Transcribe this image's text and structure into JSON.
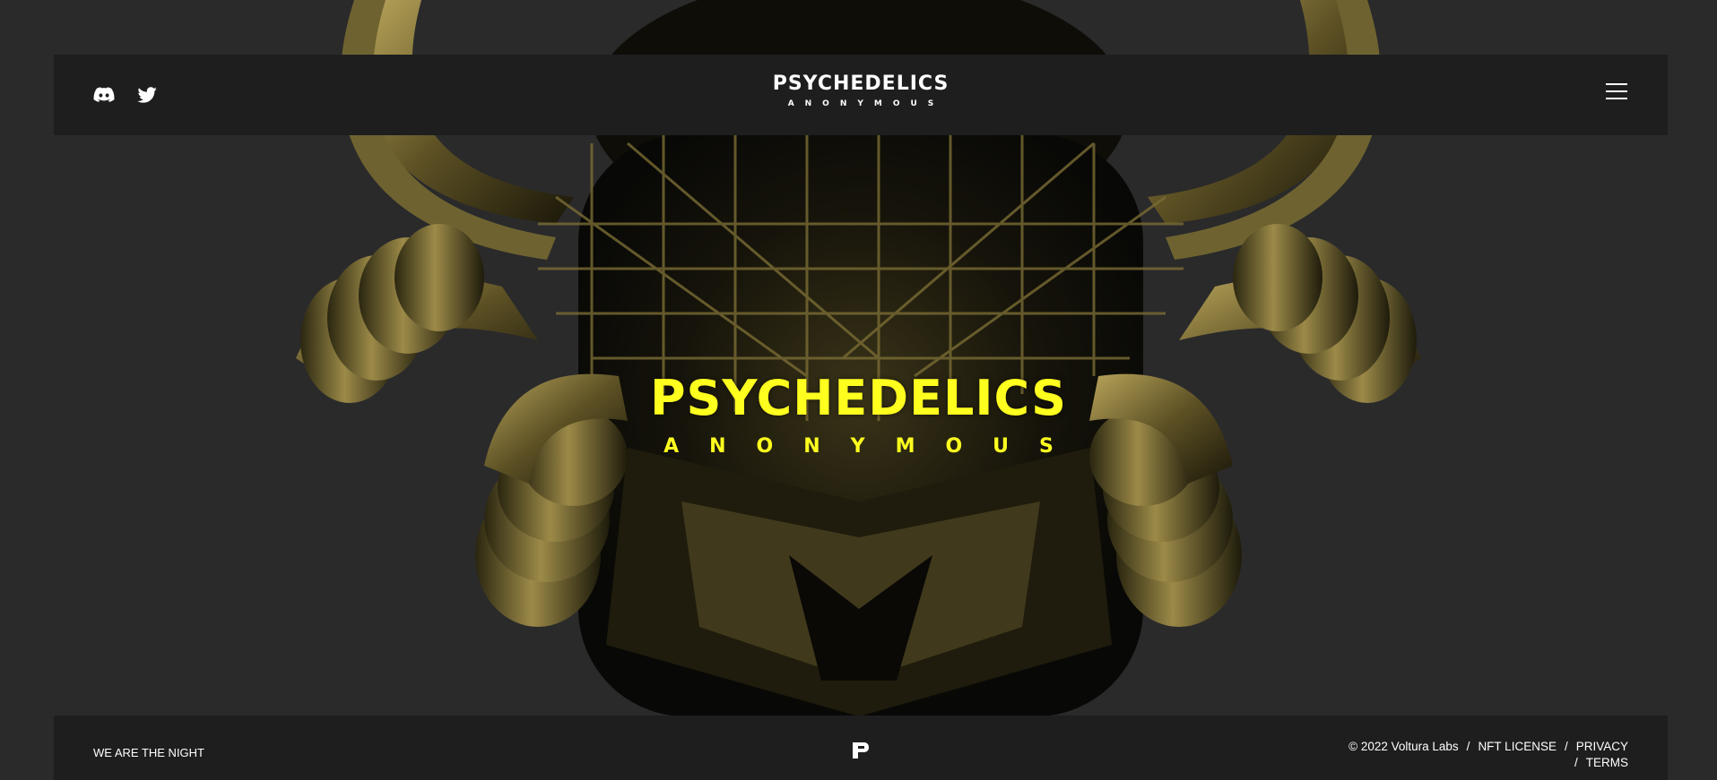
{
  "header": {
    "brand_line1": "PSYCHEDELICS",
    "brand_line2": "ANONYMOUS"
  },
  "hero": {
    "title_line1": "PSYCHEDELICS",
    "title_line2": "ANONYMOUS"
  },
  "footer": {
    "slogan": "WE ARE THE NIGHT",
    "copyright": "© 2022 Voltura Labs",
    "links": {
      "nft_license": "NFT LICENSE",
      "privacy": "PRIVACY",
      "terms": "TERMS"
    },
    "separator": "/"
  },
  "icons": [
    "discord-icon",
    "twitter-icon",
    "hamburger-menu-icon",
    "brand-p-logo-icon"
  ],
  "colors": {
    "background": "#2a2a2b",
    "bar": "#1e1e1f",
    "accent_yellow": "#ffff1f",
    "metal_gold": "#8a7a3a"
  }
}
